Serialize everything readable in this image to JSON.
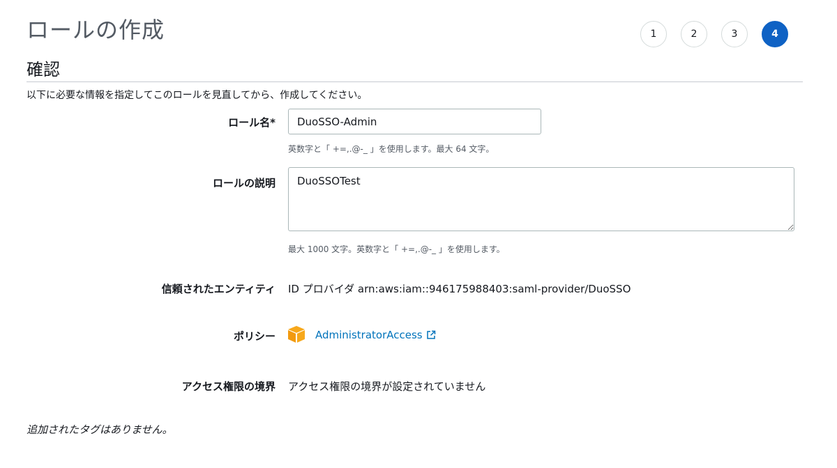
{
  "page": {
    "title": "ロールの作成"
  },
  "steps": [
    {
      "label": "1",
      "active": false
    },
    {
      "label": "2",
      "active": false
    },
    {
      "label": "3",
      "active": false
    },
    {
      "label": "4",
      "active": true
    }
  ],
  "section": {
    "title": "確認",
    "intro": "以下に必要な情報を指定してこのロールを見直してから、作成してください。"
  },
  "role_name": {
    "label": "ロール名*",
    "value": "DuoSSO-Admin",
    "hint": "英数字と「 +=,.@-_ 」を使用します。最大 64 文字。"
  },
  "role_description": {
    "label": "ロールの説明",
    "value": "DuoSSOTest",
    "hint": "最大 1000 文字。英数字と「 +=,.@-_ 」を使用します。"
  },
  "trusted_entity": {
    "label": "信頼されたエンティティ",
    "value": "ID プロバイダ arn:aws:iam::946175988403:saml-provider/DuoSSO"
  },
  "policy": {
    "label": "ポリシー",
    "link": "AdministratorAccess",
    "icon": "aws-policy-cube-icon",
    "icon_color": "#f7a81b"
  },
  "permissions_boundary": {
    "label": "アクセス権限の境界",
    "value": "アクセス権限の境界が設定されていません"
  },
  "tags": {
    "empty_text": "追加されたタグはありません。"
  },
  "colors": {
    "accent": "#0f62c4",
    "link": "#0073bb"
  }
}
